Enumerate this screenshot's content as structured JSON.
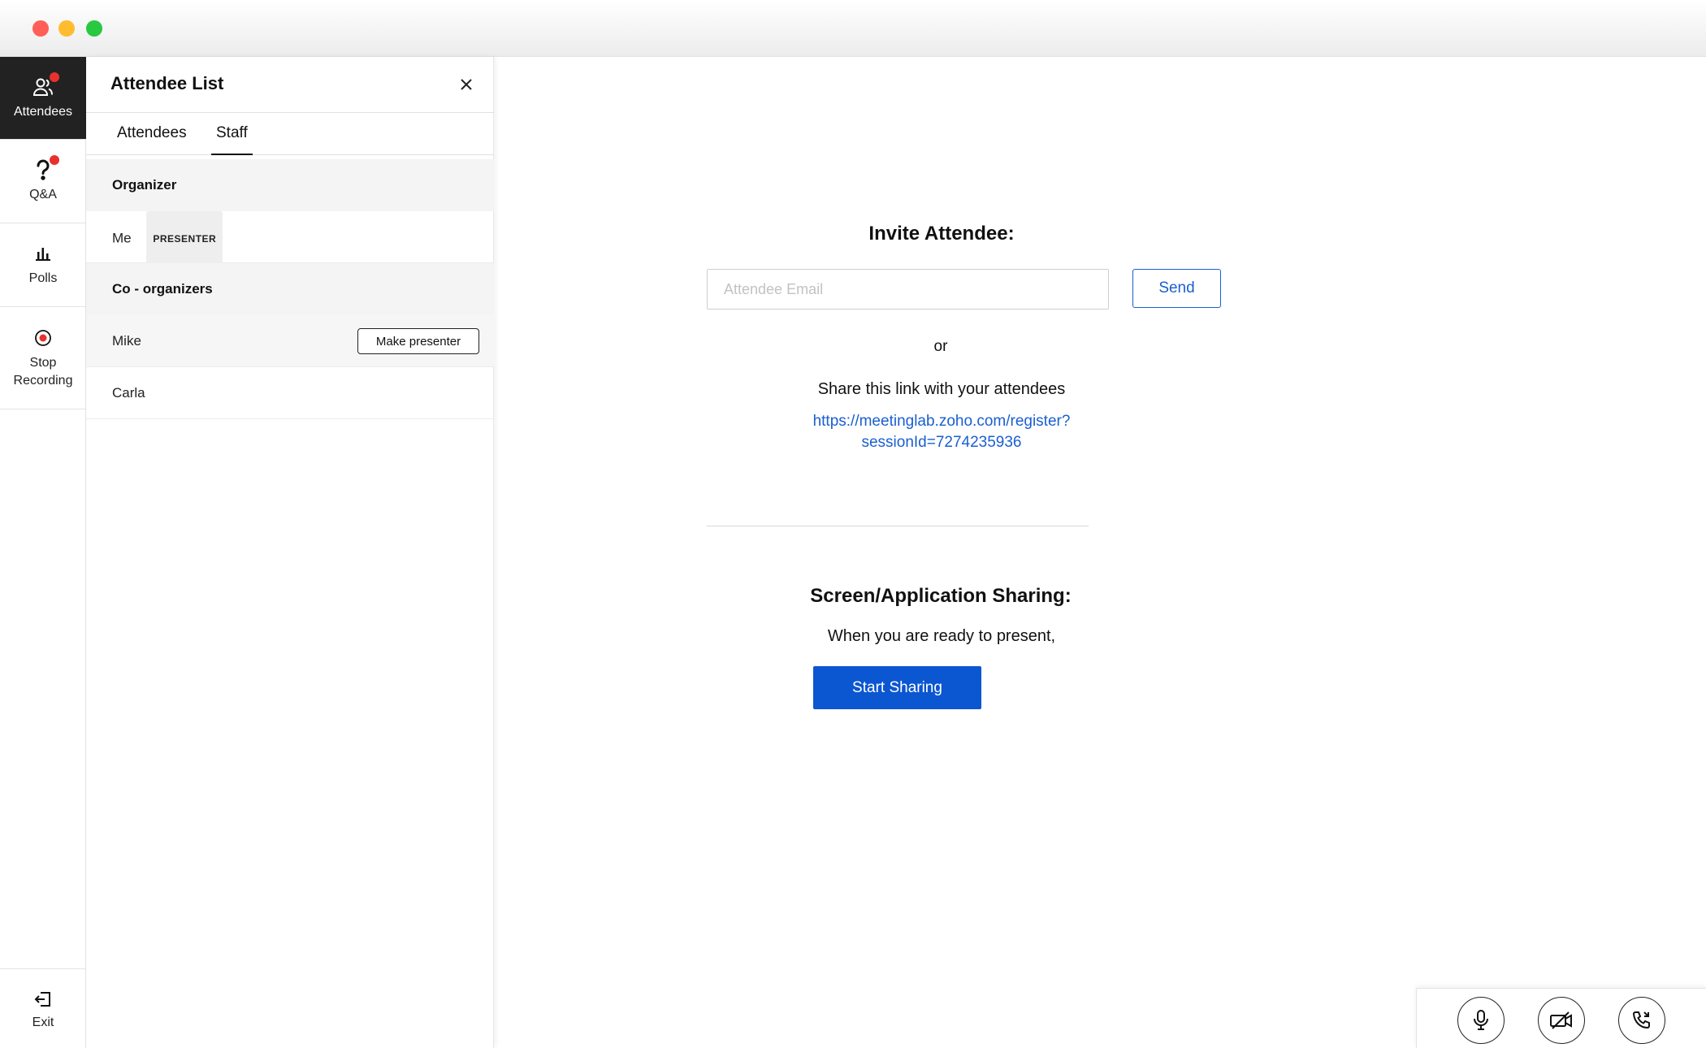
{
  "window": {
    "traffic_lights": [
      "close",
      "minimize",
      "maximize"
    ]
  },
  "colors": {
    "accent": "#0b56d1",
    "link": "#1a5fd0",
    "active_rail": "#222222",
    "notification": "#e8312f"
  },
  "rail": {
    "items": [
      {
        "label": "Attendees",
        "icon": "attendees-icon",
        "active": true,
        "notification": true
      },
      {
        "label": "Q&A",
        "icon": "question-icon",
        "active": false,
        "notification": true
      },
      {
        "label": "Polls",
        "icon": "bar-chart-icon",
        "active": false,
        "notification": false
      },
      {
        "label": "Stop\nRecording",
        "icon": "stop-record-icon",
        "active": false,
        "notification": false
      }
    ],
    "exit_label": "Exit"
  },
  "panel": {
    "title": "Attendee List",
    "tabs": [
      {
        "label": "Attendees",
        "selected": false
      },
      {
        "label": "Staff",
        "selected": true
      }
    ],
    "sections": [
      {
        "heading": "Organizer",
        "members": [
          {
            "name": "Me",
            "badge": "PRESENTER"
          }
        ]
      },
      {
        "heading": "Co - organizers",
        "members": [
          {
            "name": "Mike",
            "action": "Make presenter"
          },
          {
            "name": "Carla"
          }
        ]
      }
    ]
  },
  "invite": {
    "title": "Invite Attendee:",
    "email_placeholder": "Attendee Email",
    "email_value": "",
    "send_label": "Send",
    "or_text": "or",
    "share_text": "Share this link with your attendees",
    "link_line1": "https://meetinglab.zoho.com/register?",
    "link_line2": "sessionId=7274235936"
  },
  "sharing": {
    "title": "Screen/Application Sharing:",
    "ready_text": "When you are ready to present,",
    "start_label": "Start Sharing"
  },
  "controls": [
    {
      "icon": "microphone-icon"
    },
    {
      "icon": "camera-off-icon"
    },
    {
      "icon": "phone-icon"
    }
  ]
}
